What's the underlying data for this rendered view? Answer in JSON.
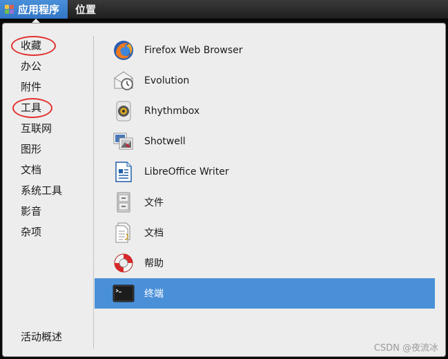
{
  "topbar": {
    "applications_label": "应用程序",
    "places_label": "位置"
  },
  "categories": [
    {
      "label": "收藏",
      "circled": true
    },
    {
      "label": "办公"
    },
    {
      "label": "附件"
    },
    {
      "label": "工具",
      "circled": true
    },
    {
      "label": "互联网"
    },
    {
      "label": "图形"
    },
    {
      "label": "文档"
    },
    {
      "label": "系统工具"
    },
    {
      "label": "影音"
    },
    {
      "label": "杂项"
    }
  ],
  "activities_label": "活动概述",
  "apps": [
    {
      "label": "Firefox Web Browser",
      "icon": "firefox-icon"
    },
    {
      "label": "Evolution",
      "icon": "evolution-icon"
    },
    {
      "label": "Rhythmbox",
      "icon": "rhythmbox-icon"
    },
    {
      "label": "Shotwell",
      "icon": "shotwell-icon"
    },
    {
      "label": "LibreOffice Writer",
      "icon": "libreoffice-writer-icon"
    },
    {
      "label": "文件",
      "icon": "file-cabinet-icon"
    },
    {
      "label": "文档",
      "icon": "documents-icon"
    },
    {
      "label": "帮助",
      "icon": "help-lifebuoy-icon"
    },
    {
      "label": "终端",
      "icon": "terminal-icon",
      "selected": true
    }
  ],
  "watermark": "CSDN @夜流冰",
  "colors": {
    "selection": "#4a90d9",
    "annotation_circle": "#e23030",
    "panel": "#1f1f1f",
    "menu_bg": "#ededed"
  }
}
